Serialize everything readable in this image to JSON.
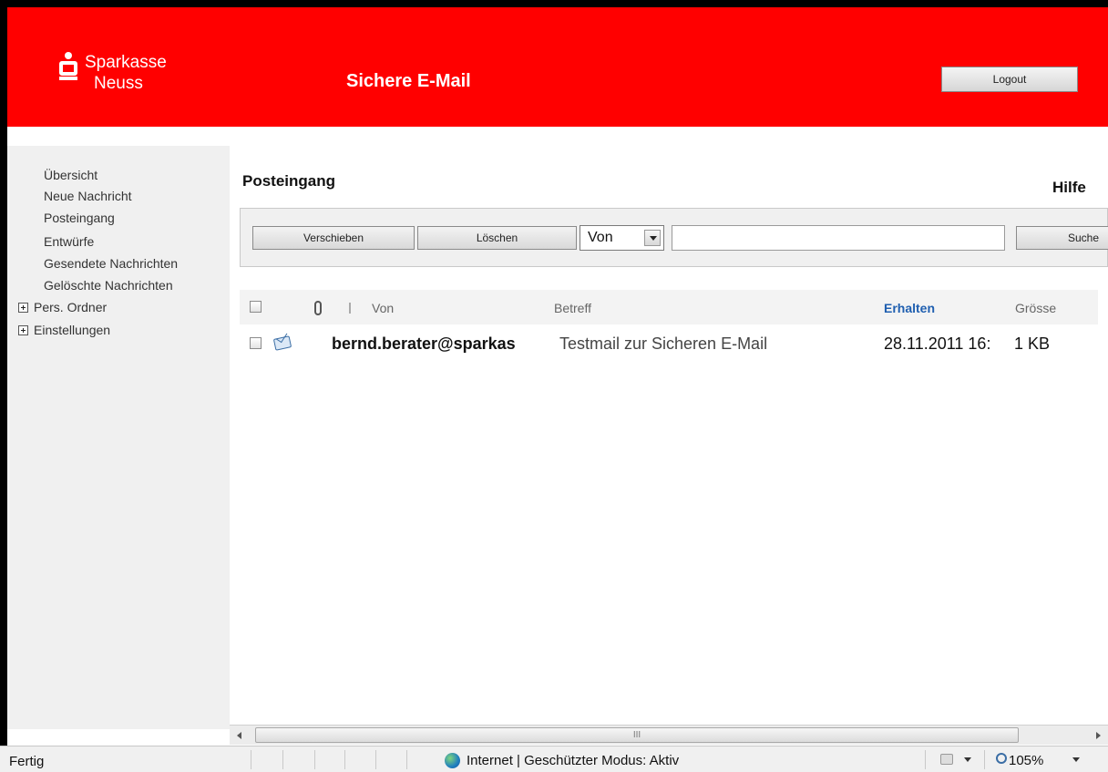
{
  "header": {
    "logo_line1": "Sparkasse",
    "logo_line2": "Neuss",
    "app_title": "Sichere E-Mail",
    "logout_label": "Logout"
  },
  "sidebar": {
    "items": [
      {
        "label": "Übersicht"
      },
      {
        "label": "Neue Nachricht"
      },
      {
        "label": "Posteingang"
      },
      {
        "label": "Entwürfe"
      },
      {
        "label": "Gesendete Nachrichten"
      },
      {
        "label": "Gelöschte Nachrichten"
      }
    ],
    "folders": [
      {
        "label": "Pers. Ordner"
      },
      {
        "label": "Einstellungen"
      }
    ]
  },
  "main": {
    "heading": "Posteingang",
    "help_label": "Hilfe",
    "toolbar": {
      "move_label": "Verschieben",
      "delete_label": "Löschen",
      "search_field_value": "Von",
      "search_query": "",
      "search_label": "Suche"
    },
    "table": {
      "columns": {
        "from": "Von",
        "subject": "Betreff",
        "received": "Erhalten",
        "size": "Grösse"
      },
      "sorted_column": "received",
      "rows": [
        {
          "from": "bernd.berater@sparkas",
          "subject": "Testmail zur Sicheren E-Mail",
          "received": "28.11.2011 16:",
          "size": "1 KB",
          "icon": "envelope-icon"
        }
      ]
    },
    "scrollbar_grip": "III"
  },
  "statusbar": {
    "status": "Fertig",
    "zone": "Internet | Geschützter Modus: Aktiv",
    "zoom": "105%"
  },
  "colors": {
    "brand_red": "#ff0000",
    "sorted_column": "#1f5fb0"
  }
}
